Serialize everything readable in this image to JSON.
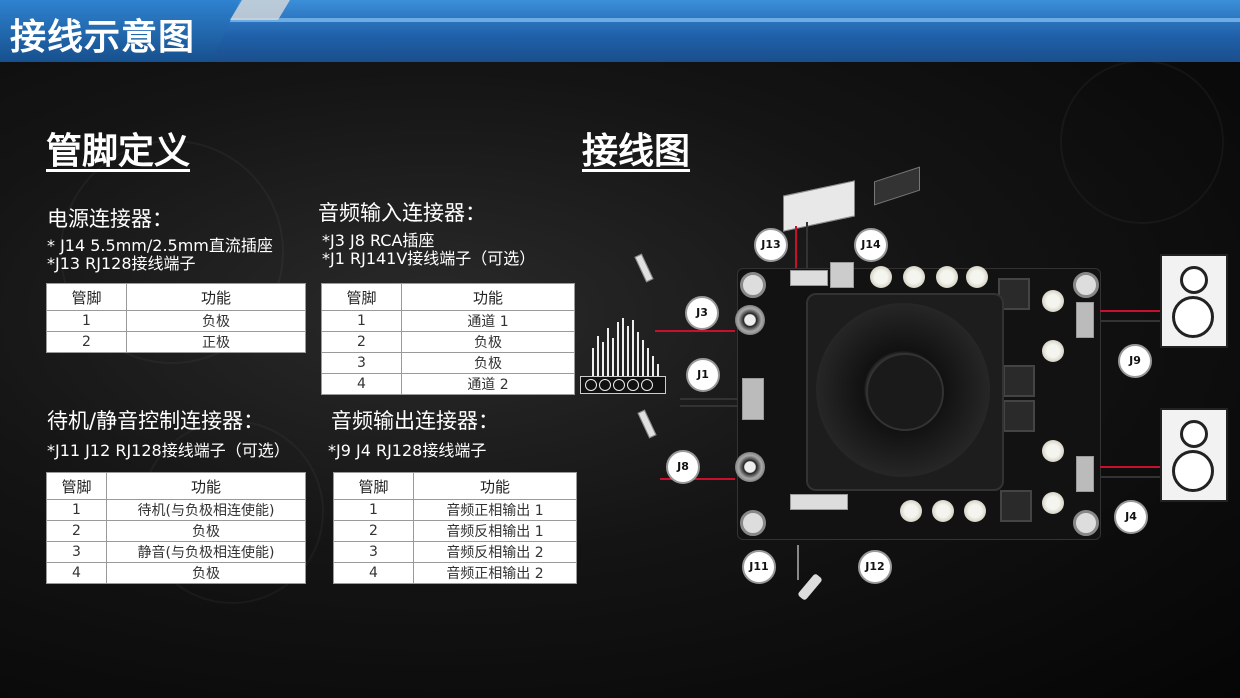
{
  "header": {
    "title": "接线示意图"
  },
  "left": {
    "section_title": "管脚定义",
    "power": {
      "title": "电源连接器：",
      "notes": [
        "* J14 5.5mm/2.5mm直流插座",
        "*J13 RJ128接线端子"
      ],
      "headers": [
        "管脚",
        "功能"
      ],
      "rows": [
        [
          "1",
          "负极"
        ],
        [
          "2",
          "正极"
        ]
      ]
    },
    "audio_in": {
      "title": "音频输入连接器：",
      "notes": [
        "*J3 J8 RCA插座",
        "*J1 RJ141V接线端子（可选）"
      ],
      "headers": [
        "管脚",
        "功能"
      ],
      "rows": [
        [
          "1",
          "通道 1"
        ],
        [
          "2",
          "负极"
        ],
        [
          "3",
          "负极"
        ],
        [
          "4",
          "通道 2"
        ]
      ]
    },
    "standby": {
      "title": "待机/静音控制连接器：",
      "notes": [
        "*J11 J12 RJ128接线端子（可选）"
      ],
      "headers": [
        "管脚",
        "功能"
      ],
      "rows": [
        [
          "1",
          "待机(与负极相连使能)"
        ],
        [
          "2",
          "负极"
        ],
        [
          "3",
          "静音(与负极相连使能)"
        ],
        [
          "4",
          "负极"
        ]
      ]
    },
    "audio_out": {
      "title": "音频输出连接器：",
      "notes": [
        "*J9 J4 RJ128接线端子"
      ],
      "headers": [
        "管脚",
        "功能"
      ],
      "rows": [
        [
          "1",
          "音频正相输出 1"
        ],
        [
          "2",
          "音频反相输出 1"
        ],
        [
          "3",
          "音频反相输出 2"
        ],
        [
          "4",
          "音频正相输出 2"
        ]
      ]
    }
  },
  "right": {
    "section_title": "接线图",
    "callouts": {
      "j13": "J13",
      "j14": "J14",
      "j3": "J3",
      "j1": "J1",
      "j8": "J8",
      "j9": "J9",
      "j4": "J4",
      "j11": "J11",
      "j12": "J12"
    }
  }
}
